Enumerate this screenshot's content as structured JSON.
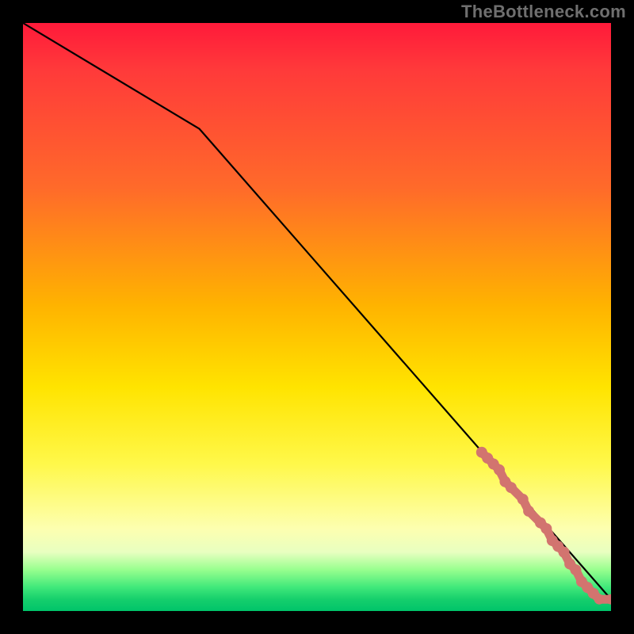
{
  "watermark": "TheBottleneck.com",
  "chart_data": {
    "type": "line",
    "title": "",
    "xlabel": "",
    "ylabel": "",
    "xlim": [
      0,
      100
    ],
    "ylim": [
      0,
      100
    ],
    "grid": false,
    "legend": false,
    "series": [
      {
        "name": "curve",
        "type": "line",
        "x": [
          0,
          30,
          100
        ],
        "y": [
          100,
          82,
          2
        ]
      },
      {
        "name": "markers",
        "type": "scatter",
        "color": "#d2746f",
        "points": [
          {
            "x": 78,
            "y": 27
          },
          {
            "x": 79,
            "y": 26
          },
          {
            "x": 80,
            "y": 25
          },
          {
            "x": 81,
            "y": 24
          },
          {
            "x": 82,
            "y": 22
          },
          {
            "x": 83,
            "y": 21
          },
          {
            "x": 85,
            "y": 19
          },
          {
            "x": 86,
            "y": 17
          },
          {
            "x": 88,
            "y": 15
          },
          {
            "x": 89,
            "y": 14
          },
          {
            "x": 90,
            "y": 12
          },
          {
            "x": 91,
            "y": 11
          },
          {
            "x": 92,
            "y": 10
          },
          {
            "x": 93,
            "y": 8
          },
          {
            "x": 94,
            "y": 7
          },
          {
            "x": 95,
            "y": 5
          },
          {
            "x": 96,
            "y": 4
          },
          {
            "x": 97,
            "y": 3
          },
          {
            "x": 98,
            "y": 2
          },
          {
            "x": 100,
            "y": 2
          }
        ]
      }
    ],
    "background_gradient": {
      "direction": "top-to-bottom",
      "stops": [
        {
          "pos": 0.0,
          "color": "#ff1a3a"
        },
        {
          "pos": 0.28,
          "color": "#ff6a2a"
        },
        {
          "pos": 0.62,
          "color": "#ffe400"
        },
        {
          "pos": 0.86,
          "color": "#fdffb0"
        },
        {
          "pos": 0.96,
          "color": "#3fe87a"
        },
        {
          "pos": 1.0,
          "color": "#00c46a"
        }
      ]
    }
  }
}
